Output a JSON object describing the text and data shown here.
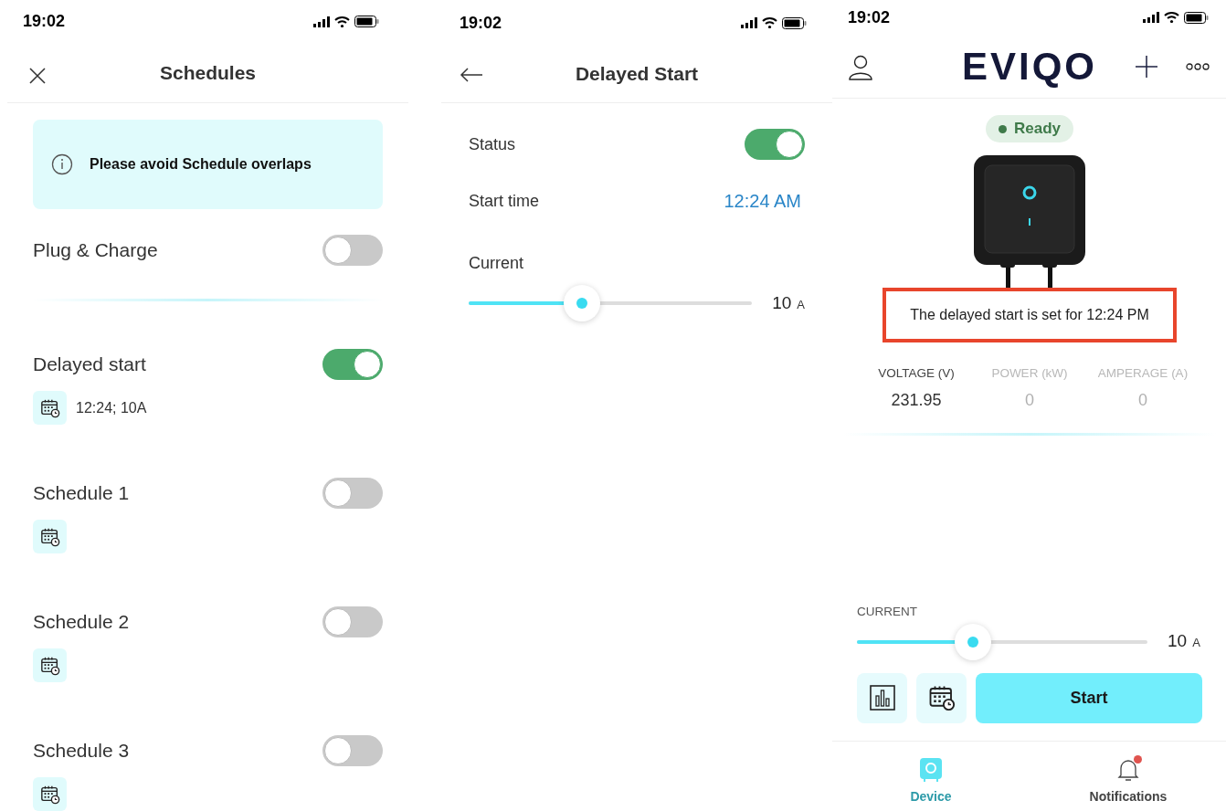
{
  "screens": [
    {
      "kind": "schedules",
      "status_bar": {
        "time": "19:02"
      },
      "header": {
        "title": "Schedules"
      },
      "notice": {
        "text": "Please avoid Schedule overlaps"
      },
      "items": [
        {
          "kind": "plain",
          "label": "Plug & Charge",
          "on": false
        },
        {
          "kind": "schedule",
          "label": "Delayed start",
          "on": true,
          "detail": "12:24; 10A"
        },
        {
          "kind": "schedule",
          "label": "Schedule 1",
          "on": false
        },
        {
          "kind": "schedule",
          "label": "Schedule 2",
          "on": false
        },
        {
          "kind": "schedule",
          "label": "Schedule 3",
          "on": false
        }
      ]
    },
    {
      "kind": "delayed_start",
      "status_bar": {
        "time": "19:02"
      },
      "header": {
        "title": "Delayed Start"
      },
      "status": {
        "label": "Status",
        "on": true
      },
      "start_time": {
        "label": "Start time",
        "value": "12:24 AM"
      },
      "current": {
        "label": "Current",
        "level": 0.4,
        "value": "10",
        "unit": "A"
      }
    },
    {
      "kind": "device",
      "status_bar": {
        "time": "19:02"
      },
      "header": {
        "logo": "EVIQO"
      },
      "status_badge": {
        "text": "Ready",
        "color": "#3f7a4a"
      },
      "message": {
        "text": "The delayed start is set for 12:24 PM"
      },
      "metrics": [
        {
          "label": "VOLTAGE (V)",
          "value": "231.95",
          "active": true
        },
        {
          "label": "POWER (kW)",
          "value": "0",
          "active": false
        },
        {
          "label": "AMPERAGE (A)",
          "value": "0",
          "active": false
        }
      ],
      "current": {
        "label": "CURRENT",
        "level": 0.4,
        "value": "10",
        "unit": "A"
      },
      "start_button": {
        "label": "Start"
      },
      "tabs": [
        {
          "label": "Device",
          "selected": true,
          "badge": false
        },
        {
          "label": "Notifications",
          "selected": false,
          "badge": true
        }
      ]
    }
  ]
}
